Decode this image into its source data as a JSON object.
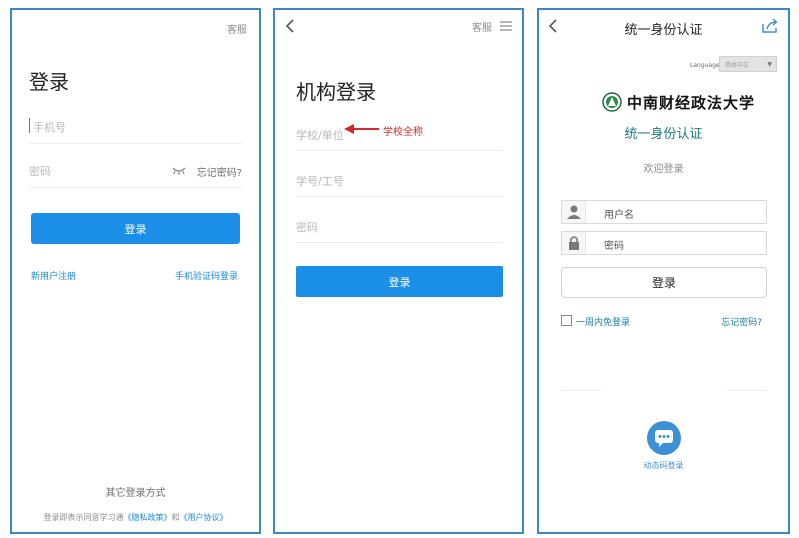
{
  "panel1": {
    "service": "客服",
    "title": "登录",
    "phone_placeholder": "手机号",
    "password_placeholder": "密码",
    "forgot": "忘记密码?",
    "login_button": "登录",
    "register": "新用户注册",
    "sms_login": "手机验证码登录",
    "other_methods": "其它登录方式",
    "agreement": {
      "prefix": "登录即表示同意学习通",
      "privacy": "《隐私政策》",
      "and": "和",
      "user_agreement": "《用户协议》"
    }
  },
  "panel2": {
    "service": "客服",
    "title": "机构登录",
    "school_placeholder": "学校/单位",
    "annotation": "学校全称",
    "id_placeholder": "学号/工号",
    "password_placeholder": "密码",
    "login_button": "登录"
  },
  "panel3": {
    "header_title": "统一身份认证",
    "language_label": "Language:",
    "language_value": "简体中文",
    "university": "中南财经政法大学",
    "auth_title": "统一身份认证",
    "welcome": "欢迎登录",
    "username_placeholder": "用户名",
    "password_placeholder": "密码",
    "login_button": "登录",
    "remember": "一周内免登录",
    "forgot": "忘记密码?",
    "dynamic_login": "动态码登录"
  },
  "colors": {
    "primary_blue": "#1b8fe8",
    "frame_border": "#3f86c9",
    "teal": "#1c7a7b",
    "annotation_red": "#d12a2a"
  },
  "icons": [
    "eye-closed-icon",
    "back-icon",
    "menu-icon",
    "share-icon",
    "user-icon",
    "lock-icon",
    "chat-icon",
    "red-arrow-icon",
    "university-logo-icon"
  ]
}
